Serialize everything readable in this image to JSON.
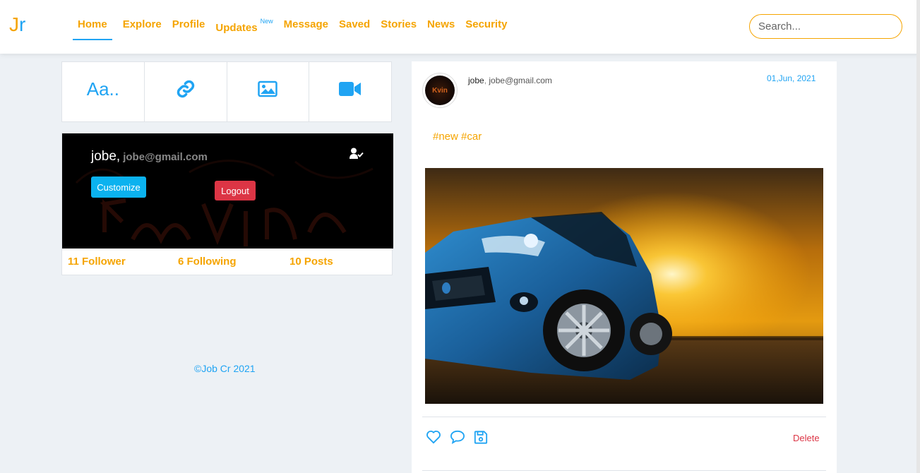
{
  "logo": {
    "first": "J",
    "second": "r"
  },
  "nav": {
    "items": [
      {
        "label": "Home",
        "active": true
      },
      {
        "label": "Explore"
      },
      {
        "label": "Profile"
      },
      {
        "label": "Updates",
        "badge": "New"
      },
      {
        "label": "Message"
      },
      {
        "label": "Saved"
      },
      {
        "label": "Stories"
      },
      {
        "label": "News"
      },
      {
        "label": "Security"
      }
    ]
  },
  "search": {
    "placeholder": "Search..."
  },
  "composer": {
    "text_label": "Aa.."
  },
  "profile": {
    "name": "jobe,",
    "email": "jobe@gmail.com",
    "customize_label": "Customize",
    "logout_label": "Logout",
    "stats": {
      "followers": "11 Follower",
      "following": "6 Following",
      "posts": "10 Posts"
    }
  },
  "footer": {
    "copyright": "©Job Cr 2021"
  },
  "post": {
    "avatar_text": "Kvin",
    "username": "jobe",
    "separator": ",",
    "email": "jobe@gmail.com",
    "date": "01,Jun, 2021",
    "tags": "#new #car",
    "delete_label": "Delete"
  },
  "colors": {
    "accent_orange": "#f5a400",
    "accent_blue": "#20a4f3",
    "danger": "#dc3545",
    "customize": "#0bb2ef"
  }
}
